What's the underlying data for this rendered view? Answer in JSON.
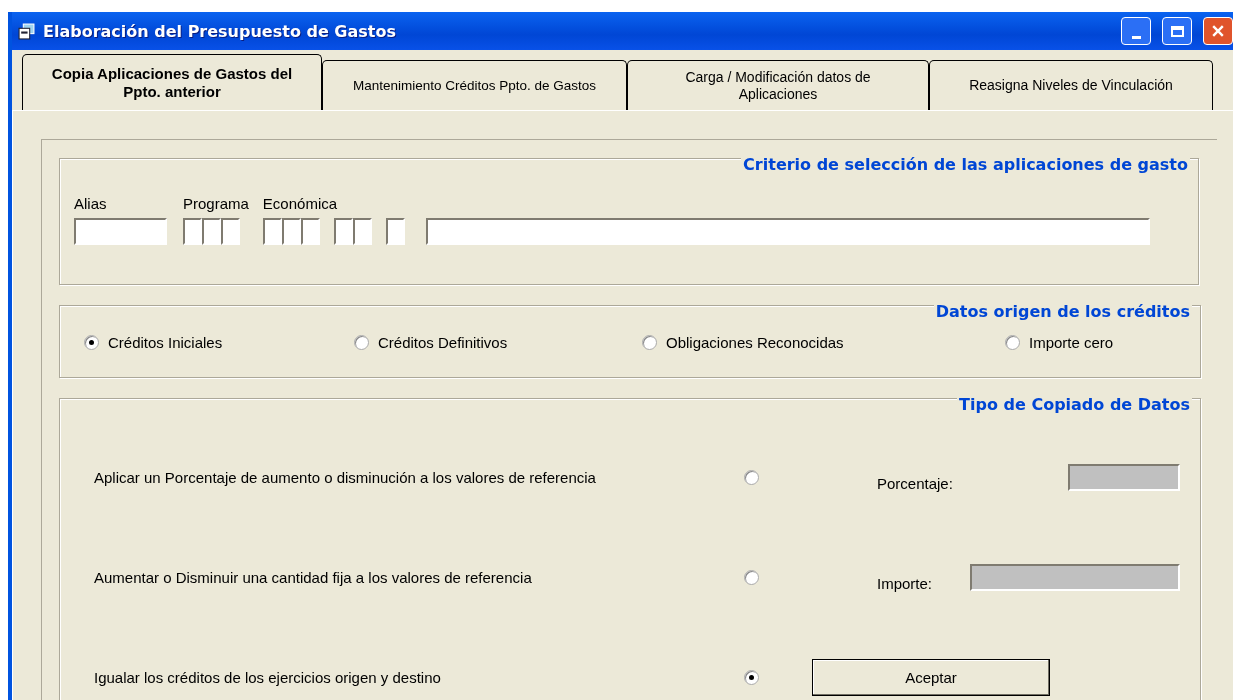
{
  "window": {
    "title": "Elaboración del Presupuesto de Gastos"
  },
  "tabs": [
    {
      "label": "Copia Aplicaciones de Gastos del Ppto. anterior",
      "selected": true
    },
    {
      "label": "Mantenimiento Créditos Ppto. de Gastos",
      "selected": false
    },
    {
      "label": "Carga / Modificación datos de Aplicaciones",
      "selected": false
    },
    {
      "label": "Reasigna Niveles de Vinculación",
      "selected": false
    }
  ],
  "selection_criteria": {
    "title": "Criterio de selección de las aplicaciones de gasto",
    "labels": [
      "Alias",
      "Programa",
      "Económica"
    ]
  },
  "credit_source": {
    "title": "Datos origen de los créditos",
    "options": [
      {
        "label": "Créditos Iniciales",
        "selected": true
      },
      {
        "label": "Créditos Definitivos",
        "selected": false
      },
      {
        "label": "Obligaciones Reconocidas",
        "selected": false
      },
      {
        "label": "Importe cero",
        "selected": false
      }
    ]
  },
  "copy_type": {
    "title": "Tipo de Copiado de Datos",
    "options": [
      {
        "label": "Aplicar un Porcentaje de aumento o disminución a los valores de referencia",
        "selected": false,
        "kind": "field",
        "field_label": "Porcentaje:",
        "disabled": true
      },
      {
        "label": "Aumentar o Disminuir una cantidad fija a los valores de referencia",
        "selected": false,
        "kind": "widefield",
        "field_label": "Importe:",
        "disabled": true
      },
      {
        "label": "Igualar los créditos de los ejercicios origen y destino",
        "selected": true,
        "kind": "button",
        "button": "Aceptar"
      }
    ]
  }
}
